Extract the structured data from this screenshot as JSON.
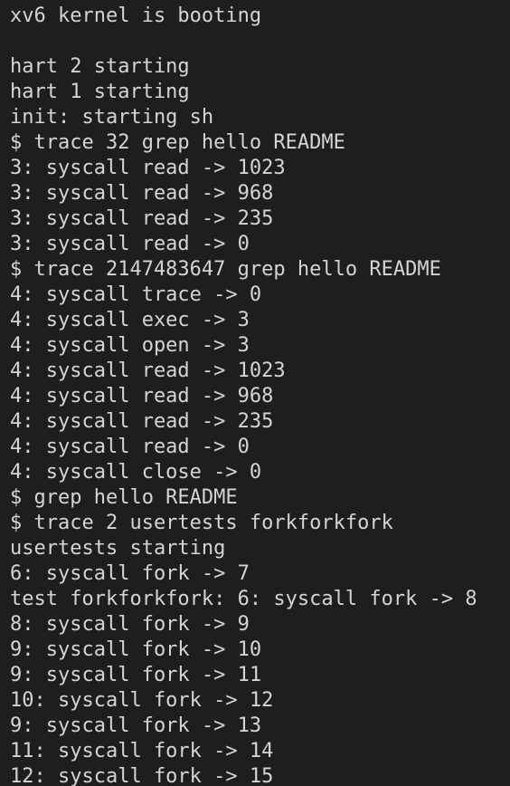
{
  "terminal": {
    "lines": [
      "xv6 kernel is booting",
      "",
      "hart 2 starting",
      "hart 1 starting",
      "init: starting sh",
      "$ trace 32 grep hello README",
      "3: syscall read -> 1023",
      "3: syscall read -> 968",
      "3: syscall read -> 235",
      "3: syscall read -> 0",
      "$ trace 2147483647 grep hello README",
      "4: syscall trace -> 0",
      "4: syscall exec -> 3",
      "4: syscall open -> 3",
      "4: syscall read -> 1023",
      "4: syscall read -> 968",
      "4: syscall read -> 235",
      "4: syscall read -> 0",
      "4: syscall close -> 0",
      "$ grep hello README",
      "$ trace 2 usertests forkforkfork",
      "usertests starting",
      "6: syscall fork -> 7",
      "test forkforkfork: 6: syscall fork -> 8",
      "8: syscall fork -> 9",
      "9: syscall fork -> 10",
      "9: syscall fork -> 11",
      "10: syscall fork -> 12",
      "9: syscall fork -> 13",
      "11: syscall fork -> 14",
      "12: syscall fork -> 15"
    ]
  },
  "colors": {
    "background": "#1e1e1e",
    "text": "#d4d4d4"
  }
}
